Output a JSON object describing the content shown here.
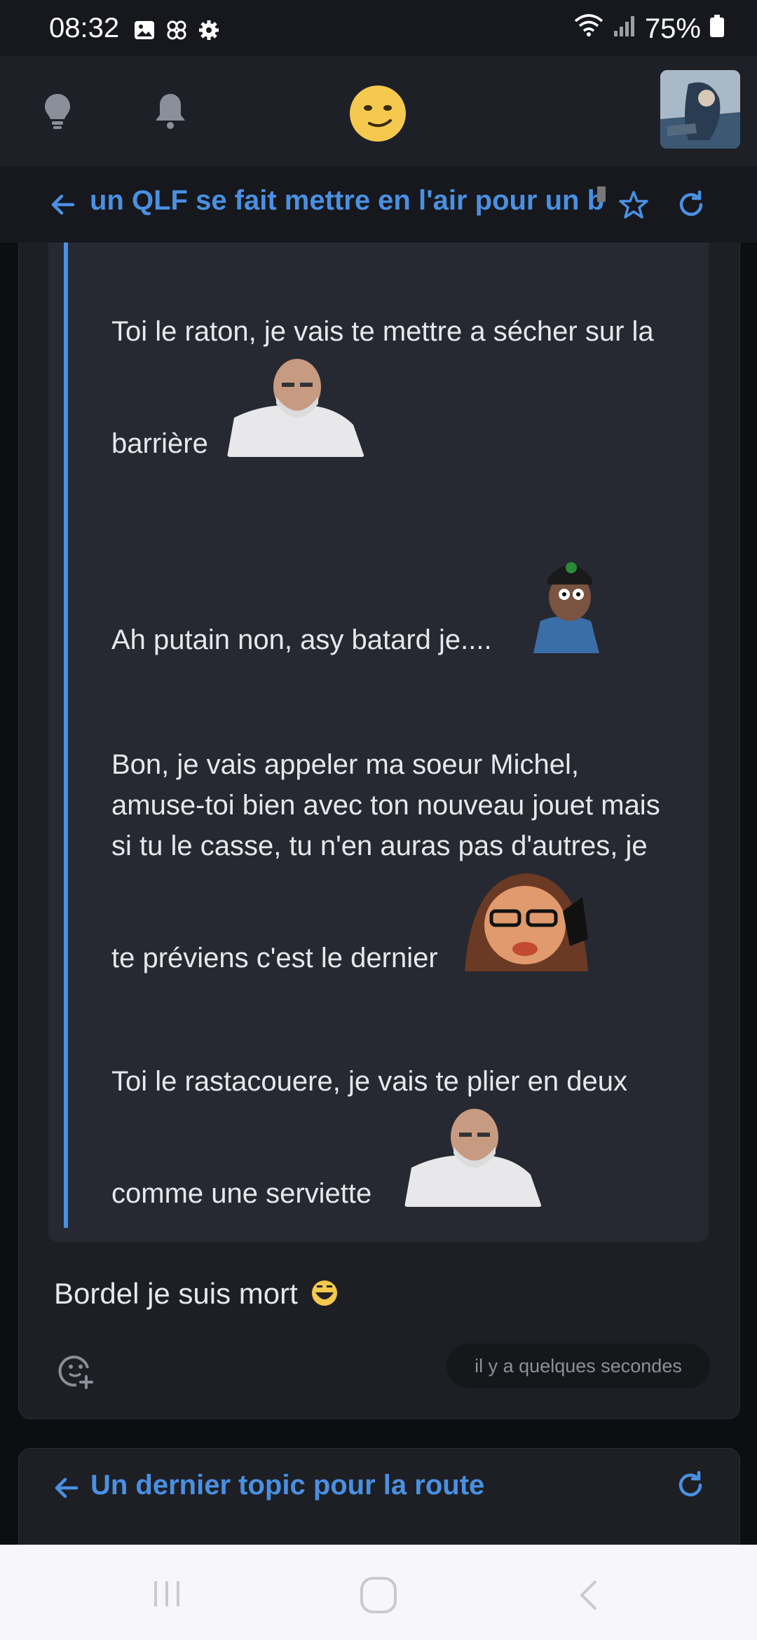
{
  "status_bar": {
    "time": "08:32",
    "battery": "75%",
    "icons": [
      "image-icon",
      "pinwheel-icon",
      "gear-icon",
      "wifi-icon",
      "signal-icon",
      "battery-icon"
    ]
  },
  "header": {
    "icons": [
      "lightbulb-icon",
      "bell-icon",
      "smirk-emoji-icon",
      "user-avatar"
    ]
  },
  "topic": {
    "title": "un QLF se fait mettre en l'air pour un b",
    "icons": [
      "back-arrow-icon",
      "star-icon",
      "refresh-icon"
    ]
  },
  "post": {
    "quote": {
      "lines": [
        "Toi le raton, je vais te mettre a sécher sur la",
        "barrière",
        "Ah putain non, asy batard je....",
        "Bon, je vais appeler ma soeur Michel,",
        "amuse-toi bien avec ton nouveau jouet mais",
        "si tu le casse, tu n'en auras pas d'autres, je",
        "te préviens c'est le dernier",
        "Toi le rastacouere, je vais te plier en deux",
        "comme une serviette"
      ]
    },
    "reply": "Bordel je suis mort",
    "timestamp": "il y a quelques secondes"
  },
  "next_topic": {
    "title": "Un dernier topic pour la route"
  },
  "colors": {
    "accent": "#4a90e2",
    "background": "#0d0e11",
    "card": "#1d1f25",
    "quote": "#262931"
  }
}
